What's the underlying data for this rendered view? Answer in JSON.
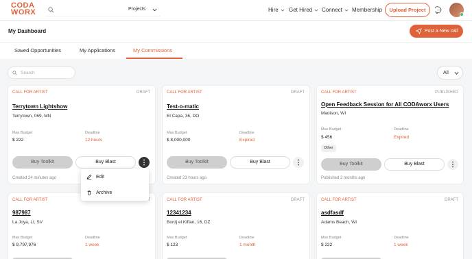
{
  "nav": {
    "logo_line1": "CODA",
    "logo_line2": "WORX",
    "search_scope": "Projects",
    "items": [
      "Hire",
      "Get Hired",
      "Connect",
      "Membership"
    ],
    "upload_label": "Upload Project"
  },
  "dashboard": {
    "title": "My Dashboard",
    "post_label": "Post a New call",
    "tabs": [
      "Saved Opportunities",
      "My Applications",
      "My Commissions"
    ],
    "active_tab": "My Commissions"
  },
  "filter": {
    "search_placeholder": "Search",
    "select_value": "All"
  },
  "labels": {
    "max_budget": "Max Budget",
    "deadline": "Deadline",
    "buy_toolkit": "Buy Toolkit",
    "buy_blast": "Buy Blast"
  },
  "cards": [
    {
      "kind": "CALL FOR ARTIST",
      "status": "DRAFT",
      "title": "Terrytown Lightshow",
      "location": "Terrytown, 069, MN",
      "budget": "$ 222",
      "deadline": "12 hours",
      "created": "Created 24 minutes ago"
    },
    {
      "kind": "CALL FOR ARTIST",
      "status": "DRAFT",
      "title": "Test-o-matic",
      "location": "El Capa, 36, DO",
      "budget": "$ 8,000,000",
      "deadline": "Expired",
      "created": "Created 23 hours ago"
    },
    {
      "kind": "CALL FOR ARTIST",
      "status": "PUBLISHED",
      "title": "Open Feedback Session for All CODAworx Users",
      "location": "Madison, WI",
      "budget": "$ 456",
      "deadline": "Expired",
      "tag": "Other",
      "created": "Published 2 months ago"
    },
    {
      "kind": "CALL FOR ARTIST",
      "status": "DRAFT",
      "title": "987987",
      "location": "La Joya, LI, SV",
      "budget": "$ 9,797,976",
      "deadline": "1 week"
    },
    {
      "kind": "CALL FOR ARTIST",
      "status": "DRAFT",
      "title": "12341234",
      "location": "Bordj el Kiffan, 16, DZ",
      "budget": "$ 123",
      "deadline": "1 month"
    },
    {
      "kind": "CALL FOR ARTIST",
      "status": "DRAFT",
      "title": "asdfasdf",
      "location": "Adams Beach, WI",
      "budget": "$ 222",
      "deadline": "1 week"
    }
  ],
  "context_menu": {
    "edit": "Edit",
    "archive": "Archive"
  },
  "colors": {
    "accent": "#e0623a",
    "background": "#f4f5f6"
  }
}
